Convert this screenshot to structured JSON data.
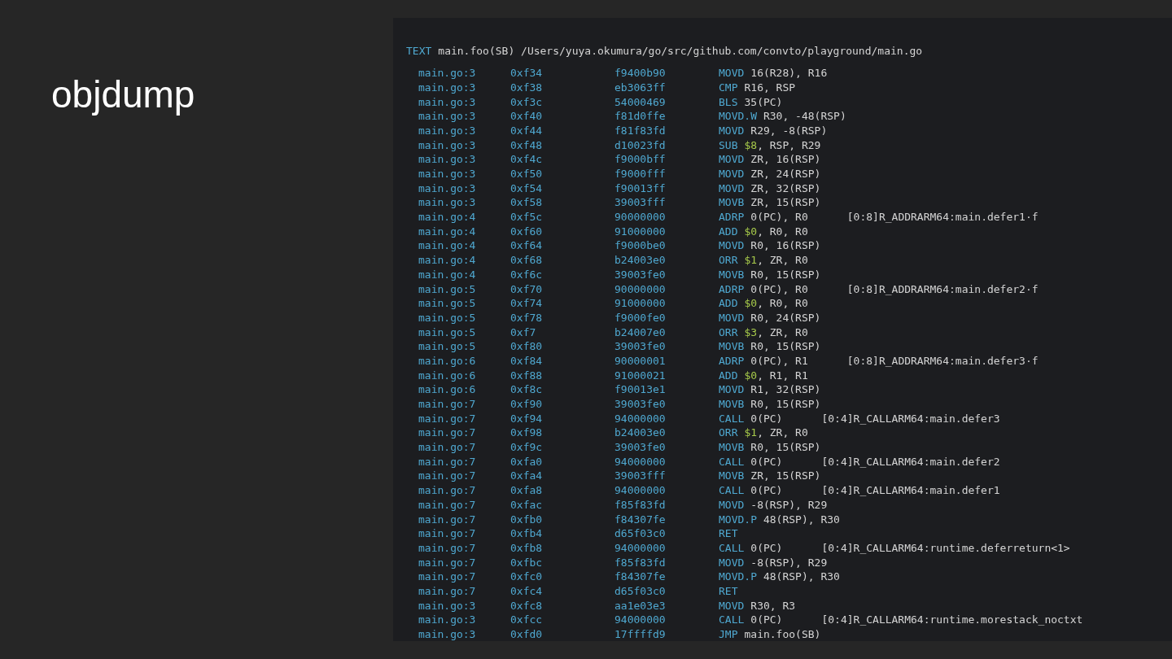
{
  "slide": {
    "title": "objdump"
  },
  "listing": {
    "header": {
      "keyword": "TEXT",
      "text": "main.foo(SB) /Users/yuya.okumura/go/src/github.com/convto/playground/main.go"
    },
    "rows": [
      {
        "file": "main.go:3",
        "addr": "0xf34",
        "hex": "f9400b90",
        "op": "MOVD",
        "args": "16(R28), R16"
      },
      {
        "file": "main.go:3",
        "addr": "0xf38",
        "hex": "eb3063ff",
        "op": "CMP",
        "args": "R16, RSP"
      },
      {
        "file": "main.go:3",
        "addr": "0xf3c",
        "hex": "54000469",
        "op": "BLS",
        "args": "35(PC)"
      },
      {
        "file": "main.go:3",
        "addr": "0xf40",
        "hex": "f81d0ffe",
        "op": "MOVD.W",
        "args": "R30, -48(RSP)"
      },
      {
        "file": "main.go:3",
        "addr": "0xf44",
        "hex": "f81f83fd",
        "op": "MOVD",
        "args": "R29, -8(RSP)"
      },
      {
        "file": "main.go:3",
        "addr": "0xf48",
        "hex": "d10023fd",
        "op": "SUB",
        "args": "$8, RSP, R29"
      },
      {
        "file": "main.go:3",
        "addr": "0xf4c",
        "hex": "f9000bff",
        "op": "MOVD",
        "args": "ZR, 16(RSP)"
      },
      {
        "file": "main.go:3",
        "addr": "0xf50",
        "hex": "f9000fff",
        "op": "MOVD",
        "args": "ZR, 24(RSP)"
      },
      {
        "file": "main.go:3",
        "addr": "0xf54",
        "hex": "f90013ff",
        "op": "MOVD",
        "args": "ZR, 32(RSP)"
      },
      {
        "file": "main.go:3",
        "addr": "0xf58",
        "hex": "39003fff",
        "op": "MOVB",
        "args": "ZR, 15(RSP)"
      },
      {
        "file": "main.go:4",
        "addr": "0xf5c",
        "hex": "90000000",
        "op": "ADRP",
        "args": "0(PC), R0",
        "reloc": "[0:8]R_ADDRARM64:main.defer1·f"
      },
      {
        "file": "main.go:4",
        "addr": "0xf60",
        "hex": "91000000",
        "op": "ADD",
        "args": "$0, R0, R0"
      },
      {
        "file": "main.go:4",
        "addr": "0xf64",
        "hex": "f9000be0",
        "op": "MOVD",
        "args": "R0, 16(RSP)"
      },
      {
        "file": "main.go:4",
        "addr": "0xf68",
        "hex": "b24003e0",
        "op": "ORR",
        "args": "$1, ZR, R0"
      },
      {
        "file": "main.go:4",
        "addr": "0xf6c",
        "hex": "39003fe0",
        "op": "MOVB",
        "args": "R0, 15(RSP)"
      },
      {
        "file": "main.go:5",
        "addr": "0xf70",
        "hex": "90000000",
        "op": "ADRP",
        "args": "0(PC), R0",
        "reloc": "[0:8]R_ADDRARM64:main.defer2·f"
      },
      {
        "file": "main.go:5",
        "addr": "0xf74",
        "hex": "91000000",
        "op": "ADD",
        "args": "$0, R0, R0"
      },
      {
        "file": "main.go:5",
        "addr": "0xf78",
        "hex": "f9000fe0",
        "op": "MOVD",
        "args": "R0, 24(RSP)"
      },
      {
        "file": "main.go:5",
        "addr": "0xf7",
        "hex": "b24007e0",
        "op": "ORR",
        "args": "$3, ZR, R0"
      },
      {
        "file": "main.go:5",
        "addr": "0xf80",
        "hex": "39003fe0",
        "op": "MOVB",
        "args": "R0, 15(RSP)"
      },
      {
        "file": "main.go:6",
        "addr": "0xf84",
        "hex": "90000001",
        "op": "ADRP",
        "args": "0(PC), R1",
        "reloc": "[0:8]R_ADDRARM64:main.defer3·f"
      },
      {
        "file": "main.go:6",
        "addr": "0xf88",
        "hex": "91000021",
        "op": "ADD",
        "args": "$0, R1, R1"
      },
      {
        "file": "main.go:6",
        "addr": "0xf8c",
        "hex": "f90013e1",
        "op": "MOVD",
        "args": "R1, 32(RSP)"
      },
      {
        "file": "main.go:7",
        "addr": "0xf90",
        "hex": "39003fe0",
        "op": "MOVB",
        "args": "R0, 15(RSP)"
      },
      {
        "file": "main.go:7",
        "addr": "0xf94",
        "hex": "94000000",
        "op": "CALL",
        "args": "0(PC)",
        "reloc": "[0:4]R_CALLARM64:main.defer3"
      },
      {
        "file": "main.go:7",
        "addr": "0xf98",
        "hex": "b24003e0",
        "op": "ORR",
        "args": "$1, ZR, R0"
      },
      {
        "file": "main.go:7",
        "addr": "0xf9c",
        "hex": "39003fe0",
        "op": "MOVB",
        "args": "R0, 15(RSP)"
      },
      {
        "file": "main.go:7",
        "addr": "0xfa0",
        "hex": "94000000",
        "op": "CALL",
        "args": "0(PC)",
        "reloc": "[0:4]R_CALLARM64:main.defer2"
      },
      {
        "file": "main.go:7",
        "addr": "0xfa4",
        "hex": "39003fff",
        "op": "MOVB",
        "args": "ZR, 15(RSP)"
      },
      {
        "file": "main.go:7",
        "addr": "0xfa8",
        "hex": "94000000",
        "op": "CALL",
        "args": "0(PC)",
        "reloc": "[0:4]R_CALLARM64:main.defer1"
      },
      {
        "file": "main.go:7",
        "addr": "0xfac",
        "hex": "f85f83fd",
        "op": "MOVD",
        "args": "-8(RSP), R29"
      },
      {
        "file": "main.go:7",
        "addr": "0xfb0",
        "hex": "f84307fe",
        "op": "MOVD.P",
        "args": "48(RSP), R30"
      },
      {
        "file": "main.go:7",
        "addr": "0xfb4",
        "hex": "d65f03c0",
        "op": "RET"
      },
      {
        "file": "main.go:7",
        "addr": "0xfb8",
        "hex": "94000000",
        "op": "CALL",
        "args": "0(PC)",
        "reloc": "[0:4]R_CALLARM64:runtime.deferreturn<1>"
      },
      {
        "file": "main.go:7",
        "addr": "0xfbc",
        "hex": "f85f83fd",
        "op": "MOVD",
        "args": "-8(RSP), R29"
      },
      {
        "file": "main.go:7",
        "addr": "0xfc0",
        "hex": "f84307fe",
        "op": "MOVD.P",
        "args": "48(RSP), R30"
      },
      {
        "file": "main.go:7",
        "addr": "0xfc4",
        "hex": "d65f03c0",
        "op": "RET"
      },
      {
        "file": "main.go:3",
        "addr": "0xfc8",
        "hex": "aa1e03e3",
        "op": "MOVD",
        "args": "R30, R3"
      },
      {
        "file": "main.go:3",
        "addr": "0xfcc",
        "hex": "94000000",
        "op": "CALL",
        "args": "0(PC)",
        "reloc": "[0:4]R_CALLARM64:runtime.morestack_noctxt"
      },
      {
        "file": "main.go:3",
        "addr": "0xfd0",
        "hex": "17ffffd9",
        "op": "JMP",
        "args": "main.foo(SB)"
      }
    ]
  }
}
